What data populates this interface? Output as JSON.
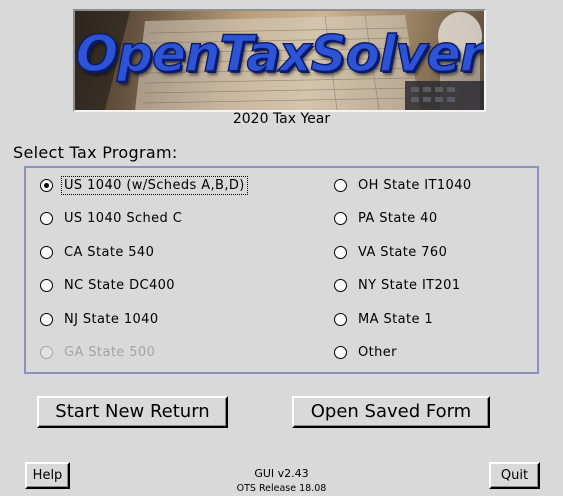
{
  "banner": {
    "title": "OpenTaxSolver"
  },
  "year_label": "2020 Tax Year",
  "select_label": "Select Tax Program:",
  "programs": {
    "us1040": {
      "label": "US 1040 (w/Scheds A,B,D)",
      "selected": true,
      "enabled": true
    },
    "us1040c": {
      "label": "US 1040 Sched C",
      "selected": false,
      "enabled": true
    },
    "ca540": {
      "label": "CA State 540",
      "selected": false,
      "enabled": true
    },
    "ncdc400": {
      "label": "NC State DC400",
      "selected": false,
      "enabled": true
    },
    "nj1040": {
      "label": "NJ State 1040",
      "selected": false,
      "enabled": true
    },
    "ga500": {
      "label": "GA State 500",
      "selected": false,
      "enabled": false
    },
    "ohit1040": {
      "label": "OH State IT1040",
      "selected": false,
      "enabled": true
    },
    "pa40": {
      "label": "PA State 40",
      "selected": false,
      "enabled": true
    },
    "va760": {
      "label": "VA State 760",
      "selected": false,
      "enabled": true
    },
    "nyit201": {
      "label": "NY State IT201",
      "selected": false,
      "enabled": true
    },
    "ma1": {
      "label": "MA State 1",
      "selected": false,
      "enabled": true
    },
    "other": {
      "label": "Other",
      "selected": false,
      "enabled": true
    }
  },
  "buttons": {
    "start_new": "Start New Return",
    "open_saved": "Open Saved Form",
    "help": "Help",
    "quit": "Quit"
  },
  "footer": {
    "gui_version": "GUI v2.43",
    "ots_release": "OTS Release 18.08"
  },
  "colors": {
    "background": "#d9d9d9",
    "frame_border": "#8a93c0",
    "banner_text": "#2d54d6",
    "disabled_text": "#a4a4a4"
  }
}
